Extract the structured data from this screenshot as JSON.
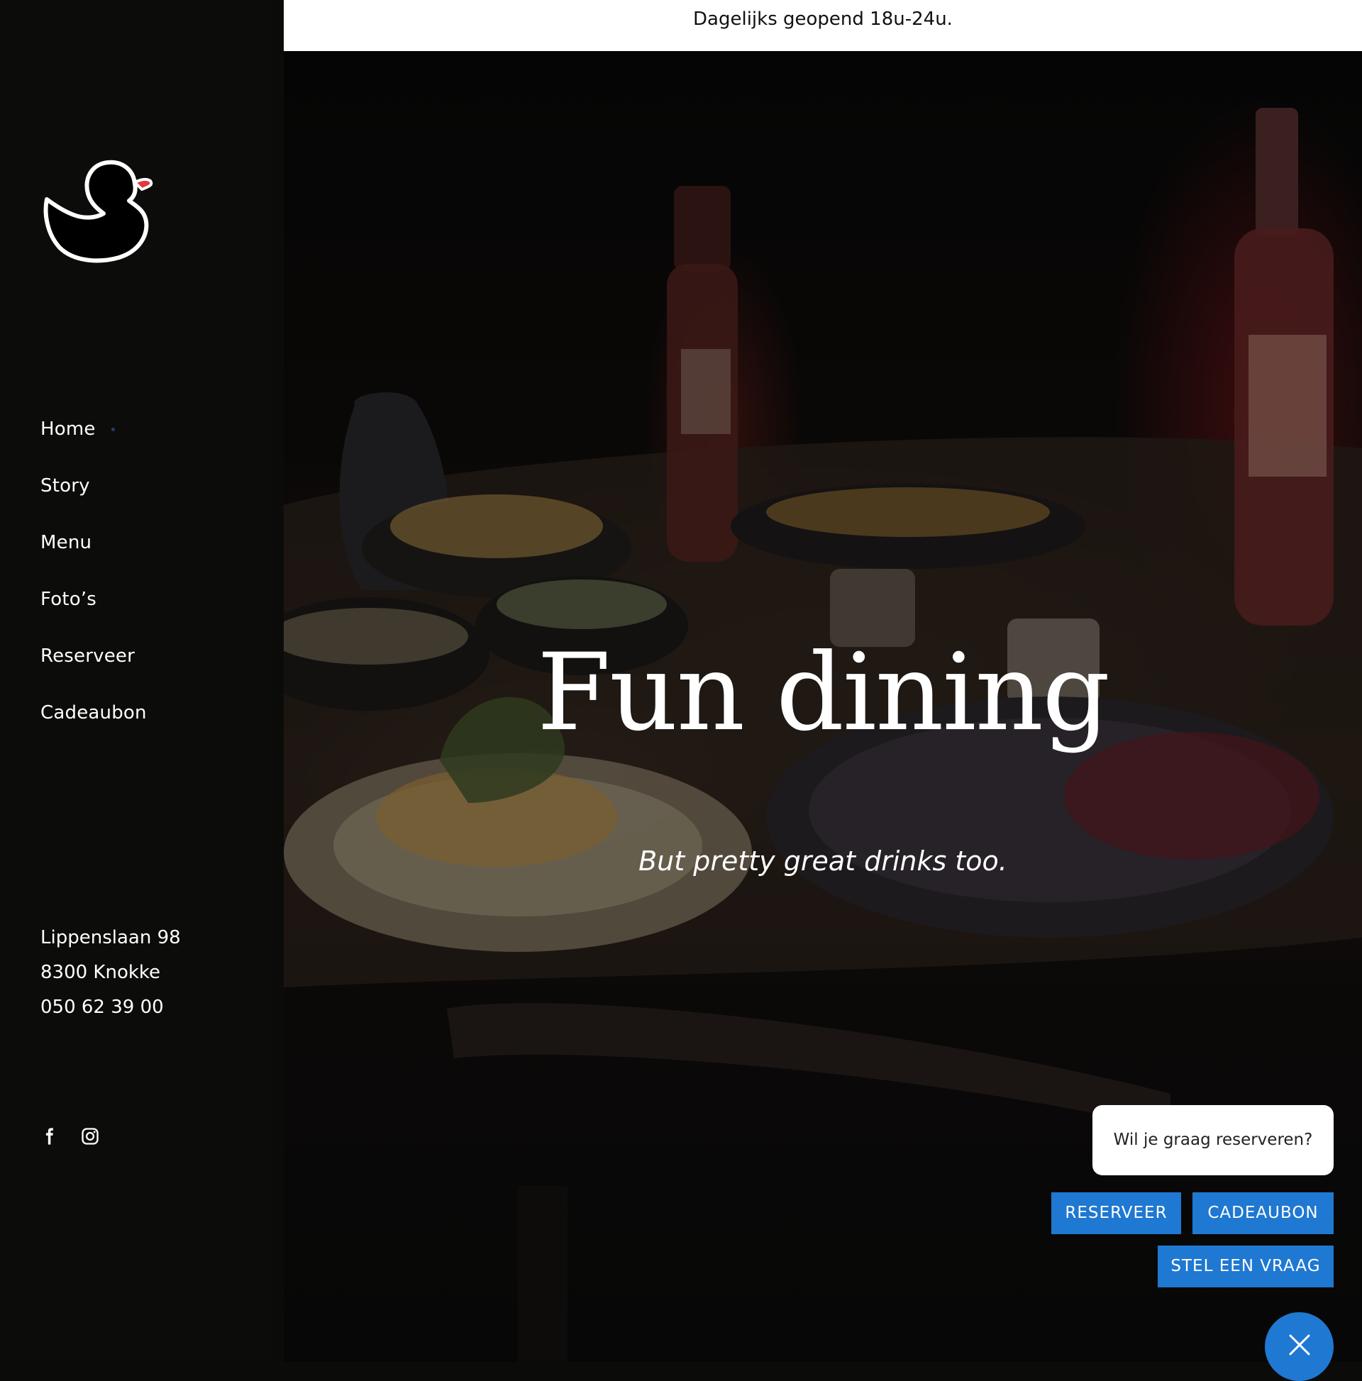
{
  "announcement": "Dagelijks geopend 18u-24u.",
  "brand": {
    "logo_icon": "duck-logo-icon",
    "beak_color": "#e0383e"
  },
  "nav": {
    "items": [
      {
        "label": "Home",
        "active": true
      },
      {
        "label": "Story"
      },
      {
        "label": "Menu"
      },
      {
        "label": "Foto’s"
      },
      {
        "label": "Reserveer"
      },
      {
        "label": "Cadeaubon"
      }
    ]
  },
  "contact": {
    "street": "Lippenslaan 98",
    "city": "8300 Knokke",
    "phone": "050 62 39 00"
  },
  "social": {
    "icons": [
      "facebook-icon",
      "instagram-icon"
    ]
  },
  "hero": {
    "title": "Fun dining",
    "subtitle": "But pretty great drinks too."
  },
  "chat": {
    "prompt": "Wil je graag reserveren?",
    "buttons": {
      "reserveer": "RESERVEER",
      "cadeaubon": "CADEAUBON",
      "vraag": "STEL EEN VRAAG"
    },
    "accent_color": "#1f78d1",
    "close_icon": "close-icon"
  }
}
